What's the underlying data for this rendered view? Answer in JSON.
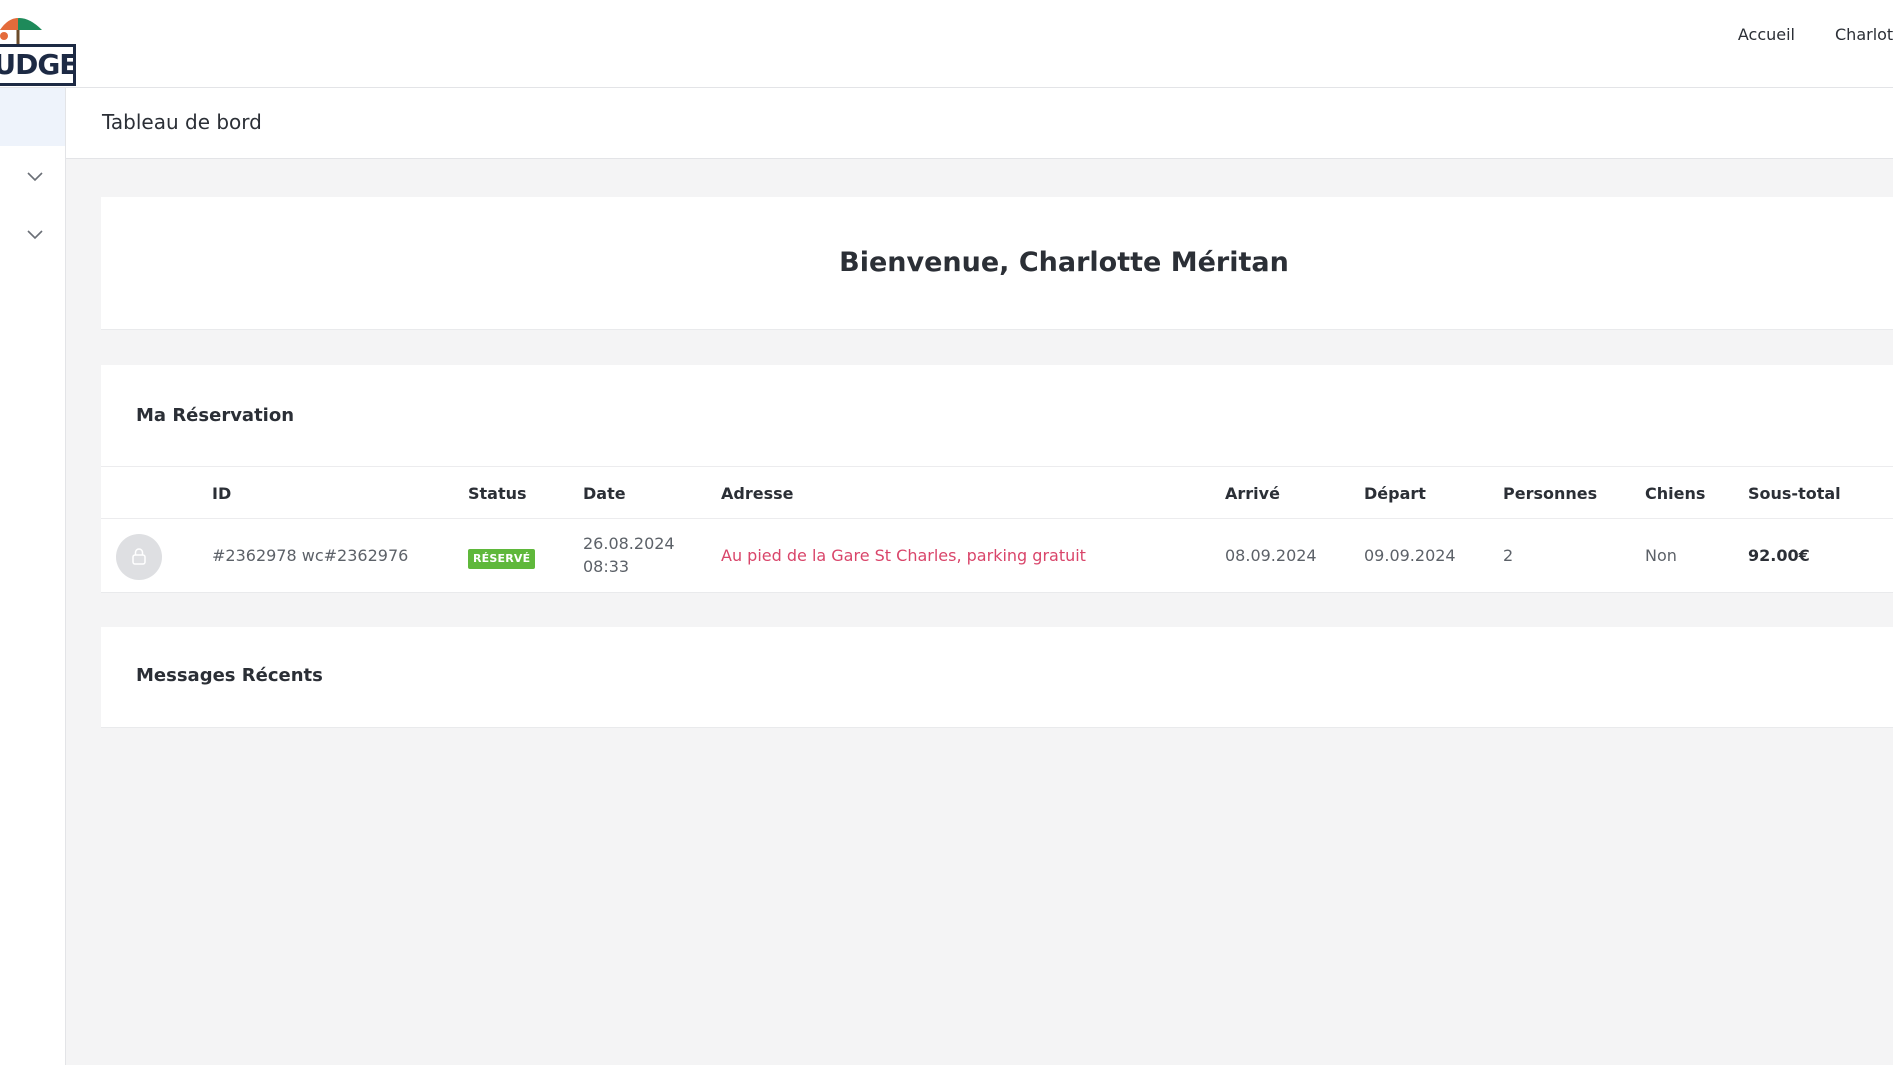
{
  "brand": {
    "logo_text": "BUDGET"
  },
  "header": {
    "nav": {
      "home": "Accueil",
      "user": "Charlotte Méritan"
    }
  },
  "sidebar": {
    "toggles": [
      "chevron-down-icon",
      "chevron-down-icon"
    ],
    "active_color": "#eef3fb"
  },
  "page": {
    "title": "Tableau de bord"
  },
  "welcome": {
    "title": "Bienvenue, Charlotte Méritan"
  },
  "reservation": {
    "title": "Ma Réservation",
    "columns": [
      "ID",
      "Status",
      "Date",
      "Adresse",
      "Arrivé",
      "Départ",
      "Personnes",
      "Chiens",
      "Sous-total"
    ],
    "rows": [
      {
        "id": "#2362978 wc#2362976",
        "status": "RÉSERVÉ",
        "date": "26.08.2024",
        "time": "08:33",
        "address": "Au pied de la Gare St Charles, parking gratuit",
        "arrival": "08.09.2024",
        "departure": "09.09.2024",
        "persons": "2",
        "dogs": "Non",
        "subtotal": "92.00€"
      }
    ]
  },
  "messages": {
    "title": "Messages Récents"
  },
  "colors": {
    "accent_link": "#d9456a",
    "status_reserved": "#5fb83b",
    "text_dark": "#2b2f36",
    "text_muted": "#5c6168"
  }
}
